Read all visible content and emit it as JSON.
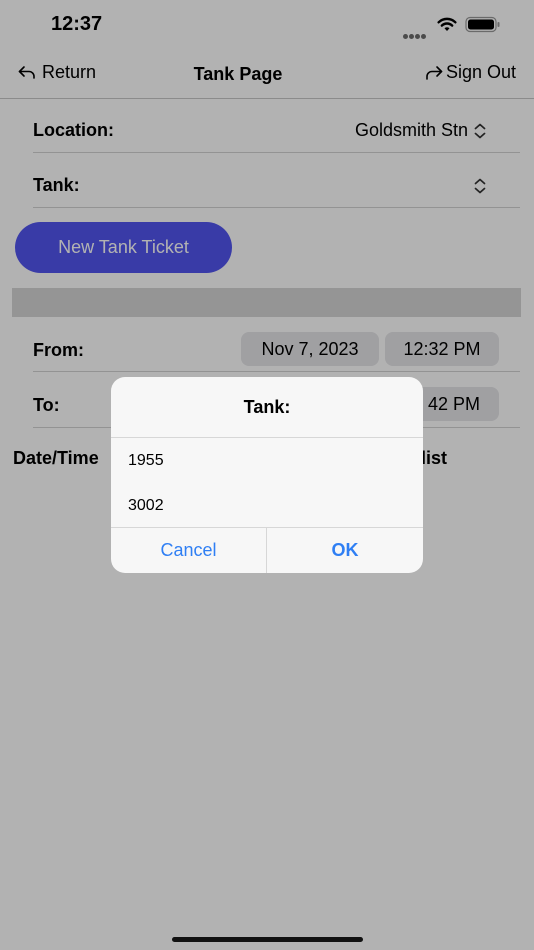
{
  "status_bar": {
    "time": "12:37"
  },
  "nav": {
    "return_label": "Return",
    "title": "Tank Page",
    "signout_label": "Sign Out"
  },
  "form": {
    "location_label": "Location:",
    "location_value": "Goldsmith Stn",
    "tank_label": "Tank:",
    "new_ticket_label": "New Tank Ticket",
    "from_label": "From:",
    "from_date": "Nov 7, 2023",
    "from_time": "12:32 PM",
    "to_label": "To:",
    "to_time_partial": "42 PM"
  },
  "list": {
    "col1_header_visible": "Date/Time",
    "col2_header_visible": "list"
  },
  "dialog": {
    "title": "Tank:",
    "options": [
      "1955",
      "3002"
    ],
    "cancel_label": "Cancel",
    "ok_label": "OK"
  },
  "colors": {
    "accent": "#5255f0",
    "link": "#2f7ff4"
  },
  "icons": [
    "return-icon",
    "signout-icon",
    "wifi-icon",
    "battery-icon",
    "updown-chevron-icon"
  ]
}
